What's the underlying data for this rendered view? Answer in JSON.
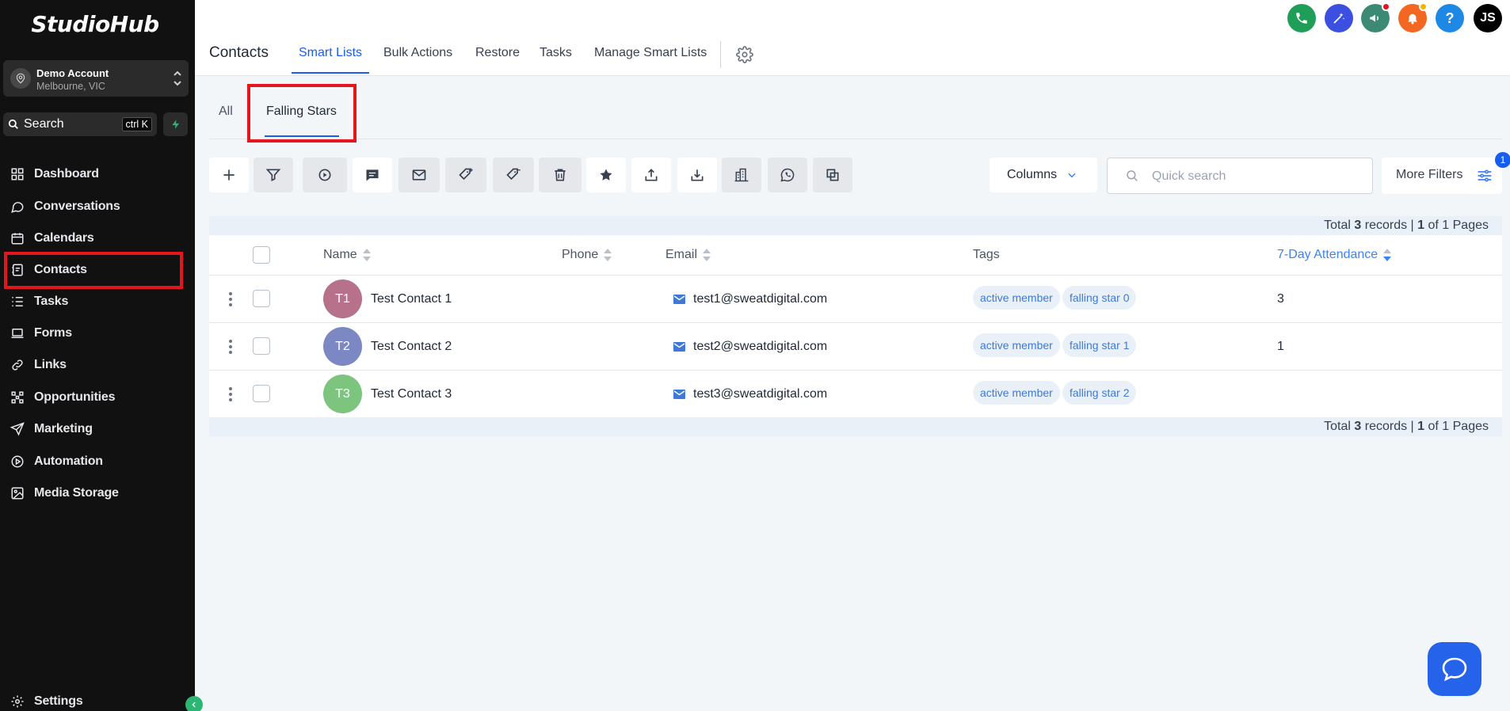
{
  "app": {
    "logo": "StudioHub"
  },
  "account": {
    "name": "Demo Account",
    "location": "Melbourne, VIC"
  },
  "sidebar": {
    "search_label": "Search",
    "search_shortcut": "ctrl K",
    "items": [
      {
        "label": "Dashboard",
        "icon": "dashboard-icon"
      },
      {
        "label": "Conversations",
        "icon": "chat-bubble-icon"
      },
      {
        "label": "Calendars",
        "icon": "calendar-icon"
      },
      {
        "label": "Contacts",
        "icon": "contact-book-icon"
      },
      {
        "label": "Tasks",
        "icon": "task-list-icon"
      },
      {
        "label": "Forms",
        "icon": "laptop-icon"
      },
      {
        "label": "Links",
        "icon": "link-icon"
      },
      {
        "label": "Opportunities",
        "icon": "network-icon"
      },
      {
        "label": "Marketing",
        "icon": "paper-plane-icon"
      },
      {
        "label": "Automation",
        "icon": "play-circle-icon"
      },
      {
        "label": "Media Storage",
        "icon": "image-icon"
      }
    ],
    "settings_label": "Settings"
  },
  "header": {
    "title": "Contacts",
    "tabs": [
      "Smart Lists",
      "Bulk Actions",
      "Restore",
      "Tasks",
      "Manage Smart Lists"
    ],
    "active_tab": "Smart Lists",
    "user_initials": "JS"
  },
  "subtabs": {
    "items": [
      "All",
      "Falling Stars"
    ],
    "active": "Falling Stars"
  },
  "toolbar": {
    "icons": [
      "plus-icon",
      "filter-icon",
      "workflow-icon",
      "message-icon",
      "email-icon",
      "add-tag-icon",
      "remove-tag-icon",
      "delete-icon",
      "star-icon",
      "export-icon",
      "import-icon",
      "company-icon",
      "whatsapp-icon",
      "merge-icon"
    ],
    "columns_label": "Columns",
    "search_placeholder": "Quick search",
    "more_filters_label": "More Filters",
    "filter_count": "1"
  },
  "table": {
    "records_text": [
      "Total ",
      "3",
      " records | ",
      "1",
      " of 1 Pages"
    ],
    "headers": {
      "name": "Name",
      "phone": "Phone",
      "email": "Email",
      "tags": "Tags",
      "attendance": "7-Day Attendance"
    },
    "rows": [
      {
        "initials": "T1",
        "name": "Test Contact 1",
        "email": "test1@sweatdigital.com",
        "tags": [
          "active member",
          "falling star 0"
        ],
        "attendance": "3",
        "avatar_color": "#b8718a"
      },
      {
        "initials": "T2",
        "name": "Test Contact 2",
        "email": "test2@sweatdigital.com",
        "tags": [
          "active member",
          "falling star 1"
        ],
        "attendance": "1",
        "avatar_color": "#7c88c4"
      },
      {
        "initials": "T3",
        "name": "Test Contact 3",
        "email": "test3@sweatdigital.com",
        "tags": [
          "active member",
          "falling star 2"
        ],
        "attendance": "",
        "avatar_color": "#7dc47e"
      }
    ]
  },
  "colors": {
    "accent": "#155eef",
    "highlight": "#e3161d",
    "sidebar_bg": "#111111"
  }
}
